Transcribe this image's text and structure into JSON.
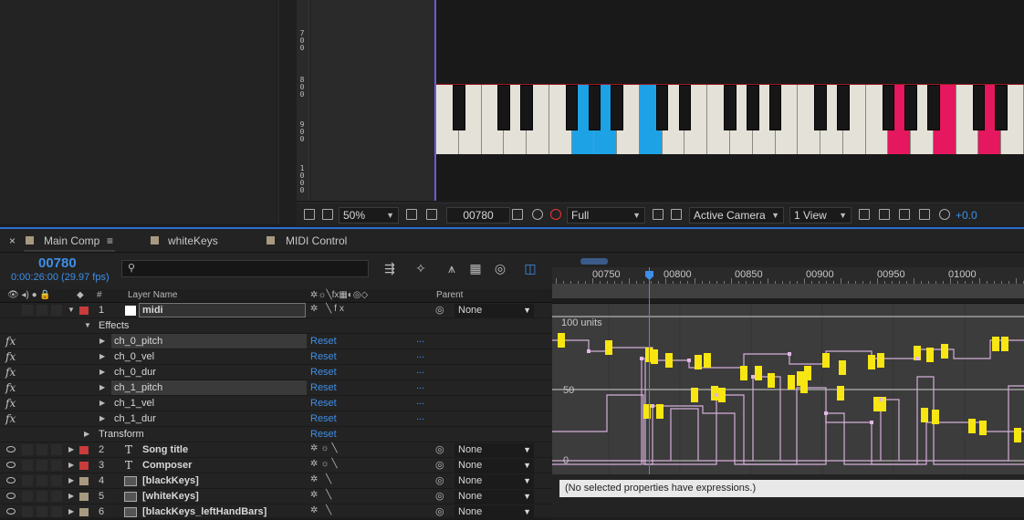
{
  "ruler": {
    "labels": [
      "7\n0\n0",
      "8\n0\n0",
      "9\n0\n0",
      "1\n0\n0\n0"
    ]
  },
  "viewer_toolbar": {
    "zoom": "50%",
    "frame": "00780",
    "resolution": "Full",
    "camera": "Active Camera",
    "views": "1 View",
    "exposure": "+0.0"
  },
  "tabs": [
    {
      "label": "Main Comp",
      "active": true
    },
    {
      "label": "whiteKeys"
    },
    {
      "label": "MIDI Control"
    }
  ],
  "timeline": {
    "timecode": "00780",
    "timecode_sub": "0:00:26:00 (29.97 fps)",
    "columns": {
      "hash": "#",
      "layer_name": "Layer Name",
      "parent": "Parent"
    }
  },
  "layers": [
    {
      "type": "layer",
      "num": "1",
      "name": "midi",
      "parent": "None",
      "color": "#c83c3c"
    },
    {
      "type": "group",
      "name": "Effects"
    },
    {
      "type": "fx",
      "name": "ch_0_pitch",
      "reset": "Reset",
      "dots": "...",
      "highlight": true
    },
    {
      "type": "fx",
      "name": "ch_0_vel",
      "reset": "Reset",
      "dots": "..."
    },
    {
      "type": "fx",
      "name": "ch_0_dur",
      "reset": "Reset",
      "dots": "..."
    },
    {
      "type": "fx",
      "name": "ch_1_pitch",
      "reset": "Reset",
      "dots": "...",
      "highlight": true
    },
    {
      "type": "fx",
      "name": "ch_1_vel",
      "reset": "Reset",
      "dots": "..."
    },
    {
      "type": "fx",
      "name": "ch_1_dur",
      "reset": "Reset",
      "dots": "..."
    },
    {
      "type": "group",
      "name": "Transform",
      "reset": "Reset"
    },
    {
      "type": "layer",
      "num": "2",
      "name": "Song title",
      "parent": "None",
      "color": "#c83c3c",
      "kind": "text"
    },
    {
      "type": "layer",
      "num": "3",
      "name": "Composer",
      "parent": "None",
      "color": "#c83c3c",
      "kind": "text"
    },
    {
      "type": "layer",
      "num": "4",
      "name": "[blackKeys]",
      "parent": "None",
      "color": "#a89a80",
      "kind": "footage"
    },
    {
      "type": "layer",
      "num": "5",
      "name": "[whiteKeys]",
      "parent": "None",
      "color": "#a89a80",
      "kind": "footage"
    },
    {
      "type": "layer",
      "num": "6",
      "name": "[blackKeys_leftHandBars]",
      "parent": "None",
      "color": "#a89a80",
      "kind": "footage"
    }
  ],
  "time_ruler": {
    "ticks": [
      "00750",
      "00800",
      "00850",
      "00900",
      "00950",
      "01000"
    ]
  },
  "graph": {
    "axis_labels": [
      "100 units",
      "50",
      "0"
    ]
  },
  "expression_message": "(No selected properties have expressions.)",
  "colors": {
    "accent_blue": "#3d8fe8",
    "key_blue": "#1ea2e6",
    "key_red": "#e5175e",
    "keyframe_yellow": "#f7e612",
    "graph_line": "#d4aed8"
  }
}
